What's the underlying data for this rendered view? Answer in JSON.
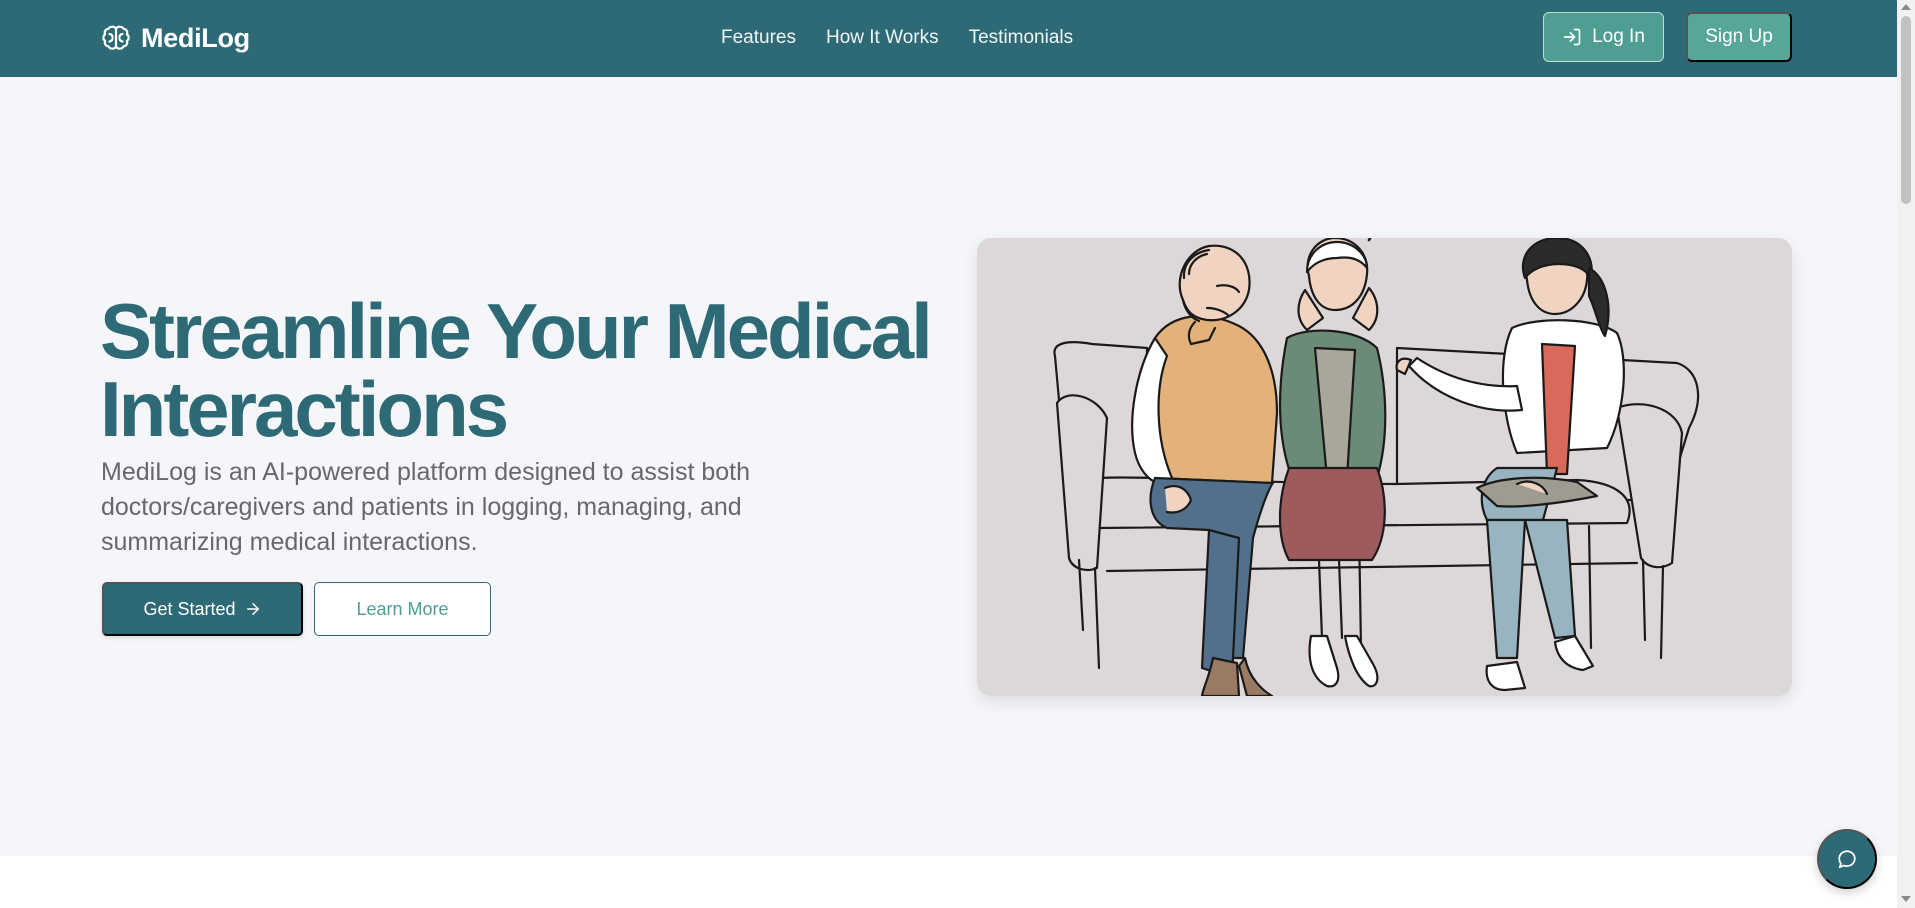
{
  "navbar": {
    "brand": {
      "name": "MediLog",
      "icon": "brain-icon"
    },
    "links": [
      {
        "label": "Features"
      },
      {
        "label": "How It Works"
      },
      {
        "label": "Testimonials"
      }
    ],
    "login": {
      "label": "Log In",
      "icon": "log-in-icon"
    },
    "signup": {
      "label": "Sign Up"
    }
  },
  "hero": {
    "title_line1": "Streamline Your Medical",
    "title_line2": "Interactions",
    "description": "MediLog is an AI-powered platform designed to assist both doctors/caregivers and patients in logging, managing, and summarizing medical interactions.",
    "primary_cta": {
      "label": "Get Started",
      "icon": "arrow-right-icon"
    },
    "secondary_cta": {
      "label": "Learn More"
    },
    "illustration": {
      "subject": "caregiver-consoling-elderly-patients",
      "icon": "illustration"
    }
  },
  "chat_widget": {
    "icon": "chat-bubble-icon"
  },
  "colors": {
    "primary": "#2e6a76",
    "accent": "#57a69a",
    "background": "#f5f6fa",
    "text_muted": "#66686d",
    "illustration_bg": "#ddd7d7"
  }
}
